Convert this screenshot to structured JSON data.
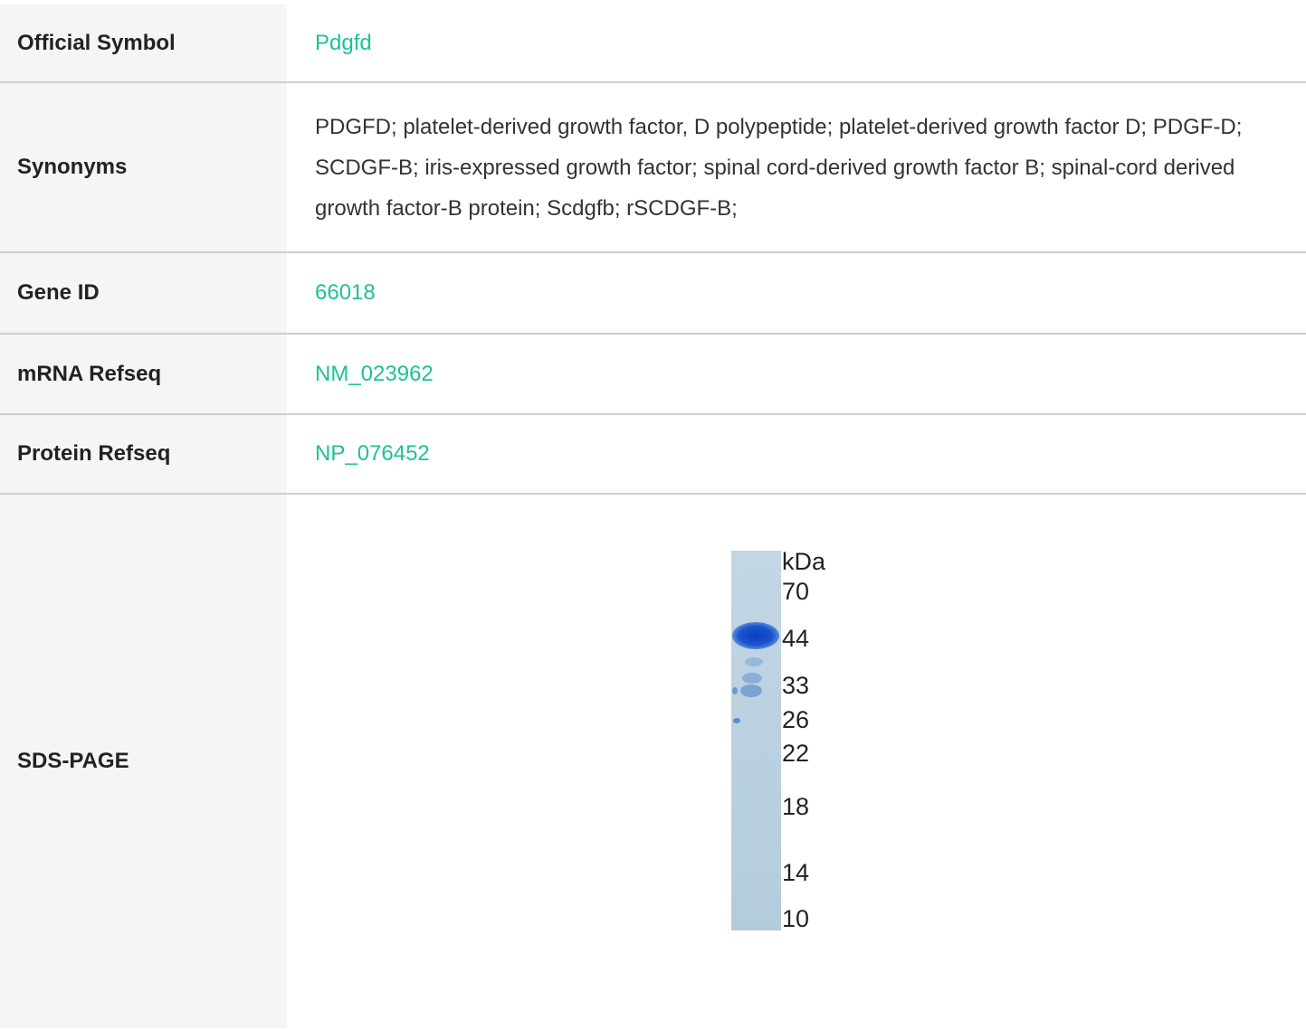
{
  "rows": [
    {
      "label": "Official Symbol",
      "value": "Pdgfd",
      "link": true
    },
    {
      "label": "Synonyms",
      "value": "PDGFD; platelet-derived growth factor, D polypeptide; platelet-derived growth factor D; PDGF-D; SCDGF-B; iris-expressed growth factor; spinal cord-derived growth factor B; spinal-cord derived growth factor-B protein; Scdgfb; rSCDGF-B;",
      "link": false
    },
    {
      "label": "Gene ID",
      "value": "66018",
      "link": true
    },
    {
      "label": "mRNA Refseq",
      "value": "NM_023962",
      "link": true
    },
    {
      "label": "Protein Refseq",
      "value": "NP_076452",
      "link": true
    },
    {
      "label": "SDS-PAGE",
      "value": "",
      "link": false
    }
  ],
  "gel": {
    "unit": "kDa",
    "markers": [
      "70",
      "44",
      "33",
      "26",
      "22",
      "18",
      "14",
      "10"
    ],
    "band_marker": "44"
  },
  "colors": {
    "link": "#1ec09b",
    "label_bg": "#f5f5f5",
    "divider": "#cfcfcf",
    "gel_lane": "#b9d0df",
    "band": "#1a53c8"
  }
}
